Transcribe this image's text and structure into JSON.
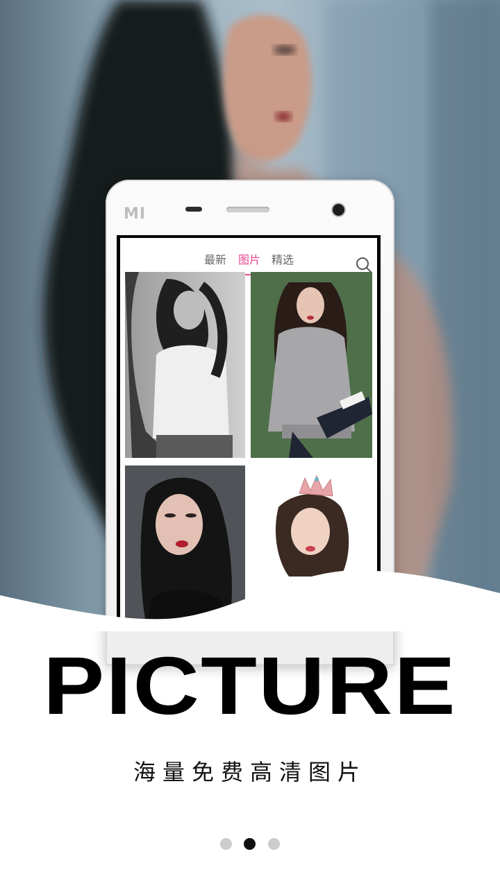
{
  "phone": {
    "brand_logo": "MI",
    "tabs": [
      {
        "label": "最新",
        "active": false
      },
      {
        "label": "图片",
        "active": true
      },
      {
        "label": "精选",
        "active": false
      }
    ],
    "search_icon": "search-icon",
    "accent_color": "#e8488f",
    "thumbnails": [
      {
        "description_icon": "photo-thumbnail"
      },
      {
        "description_icon": "photo-thumbnail"
      },
      {
        "description_icon": "photo-thumbnail"
      },
      {
        "description_icon": "photo-thumbnail"
      }
    ]
  },
  "headline": "PICTURE",
  "subtitle": "海量免费高清图片",
  "pager": {
    "count": 3,
    "active_index": 1
  }
}
